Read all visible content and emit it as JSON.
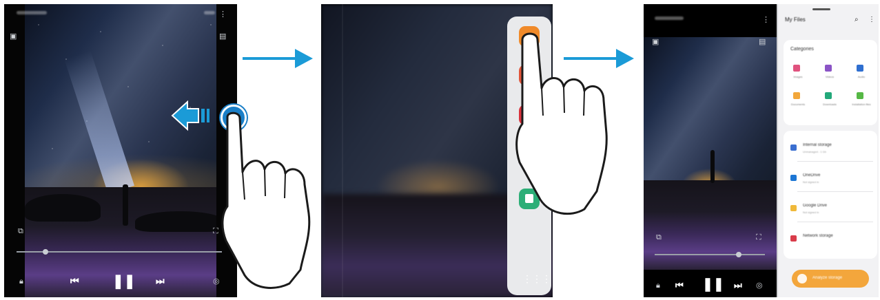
{
  "steps": {
    "step1": {
      "description_controls": [
        "rewind-icon",
        "pause-icon",
        "forward-icon"
      ]
    }
  },
  "my_files": {
    "title": "My Files",
    "categories_heading": "Categories",
    "categories": [
      {
        "name": "Images",
        "color": "#e0527e",
        "icon": "image-icon"
      },
      {
        "name": "Videos",
        "color": "#8b54c6",
        "icon": "video-icon"
      },
      {
        "name": "Audio",
        "color": "#2f6fd0",
        "icon": "audio-icon"
      },
      {
        "name": "Documents",
        "color": "#f2a73b",
        "icon": "document-icon"
      },
      {
        "name": "Downloads",
        "color": "#23a87a",
        "icon": "download-icon"
      },
      {
        "name": "Installation files",
        "color": "#56b845",
        "icon": "apk-icon"
      }
    ],
    "storage": [
      {
        "name": "Internal storage",
        "sub": "Unmanaged - 1 Gb",
        "color": "#3b6fd0",
        "icon": "phone-icon"
      },
      {
        "name": "OneDrive",
        "sub": "Not signed in",
        "color": "#1c76d4",
        "icon": "cloud-icon"
      },
      {
        "name": "Google Drive",
        "sub": "Not signed in",
        "color": "#f0b93a",
        "icon": "drive-icon"
      },
      {
        "name": "Network storage",
        "sub": "",
        "color": "#d93c4a",
        "icon": "network-icon"
      }
    ],
    "search_label": "Analyze storage"
  },
  "colors": {
    "arrow": "#1b9bd7",
    "accent_orange": "#f3a63c",
    "touch_circle": "#1b7fc7"
  }
}
